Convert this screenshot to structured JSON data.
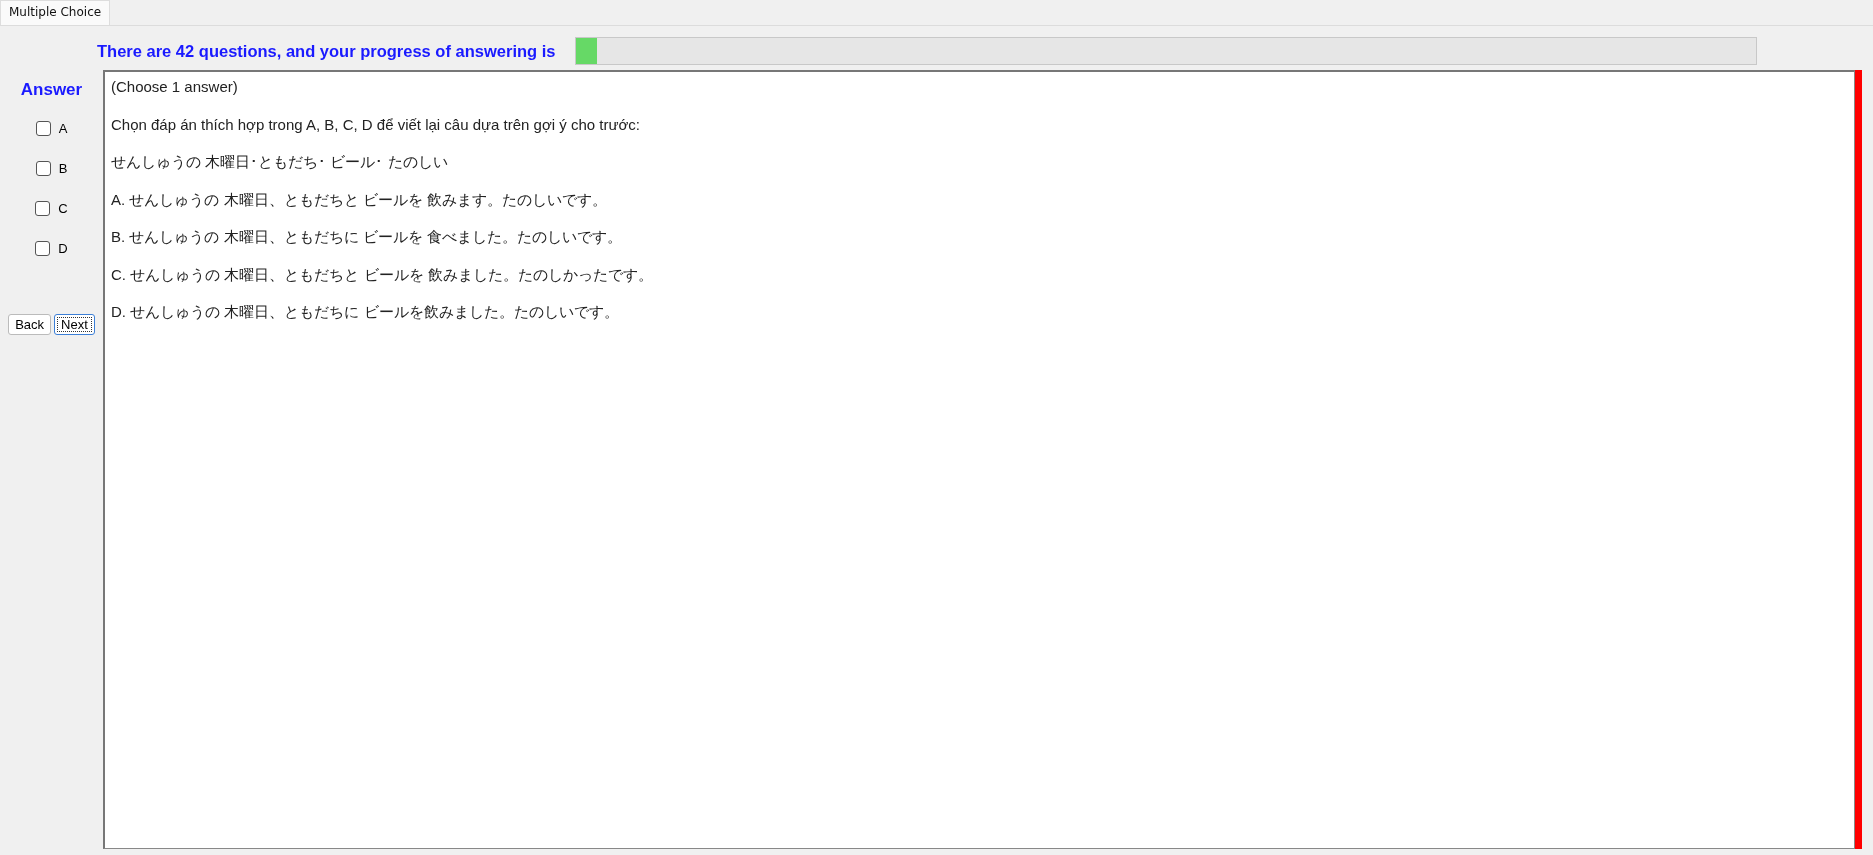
{
  "tab": {
    "label": "Multiple Choice",
    "selected": true
  },
  "progress": {
    "label": "There are 42 questions, and your progress of answering is",
    "level": 0.017
  },
  "answer": {
    "title": "Answer",
    "options": [
      {
        "label": "A",
        "checked": false
      },
      {
        "label": "B",
        "checked": false
      },
      {
        "label": "C",
        "checked": false
      },
      {
        "label": "D",
        "checked": false
      }
    ]
  },
  "buttons": [
    {
      "label": "Back",
      "focused": false
    },
    {
      "label": "Next",
      "focused": true
    }
  ],
  "question": {
    "lines": [
      "(Choose 1 answer)",
      "Chọn đáp án thích hợp trong A, B, C, D để viết lại câu dựa trên gợi ý cho trước:",
      "せんしゅうの 木曜日･ともだち･ ビール･ たのしい",
      "A.  せんしゅうの 木曜日、ともだちと   ビールを 飲みます。たのしいです。",
      "B.  せんしゅうの 木曜日、ともだちに   ビールを 食べました。たのしいです。",
      "C.  せんしゅうの 木曜日、ともだちと   ビールを 飲みました。たのしかったです。",
      "D.  せんしゅうの 木曜日、ともだちに   ビールを飲みました。たのしいです。"
    ]
  }
}
